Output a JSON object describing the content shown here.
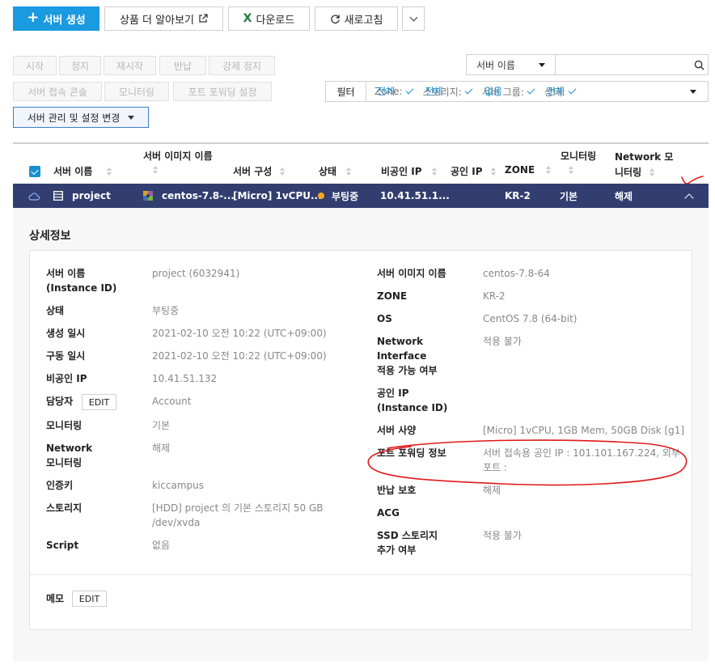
{
  "toolbar": {
    "create": "서버 생성",
    "learn_more": "상품 더 알아보기",
    "download": "다운로드",
    "refresh": "새로고침"
  },
  "actions": {
    "start": "시작",
    "stop": "정지",
    "restart": "재시작",
    "return": "반납",
    "force_stop": "강제 정지",
    "console": "서버 접속 콘솔",
    "monitoring": "모니터링",
    "port_forward": "포트 포워딩 설정",
    "manage": "서버 관리 및 설정 변경"
  },
  "search": {
    "field": "서버 이름",
    "placeholder": ""
  },
  "filter": {
    "label": "필터",
    "zone_label": "Zone:",
    "zone_val": "전체",
    "storage_label": "스토리지:",
    "storage_val": "전체",
    "group_label": "서버 그룹:",
    "group_val": "없음",
    "status_label": "상태:",
    "status_val": "전체"
  },
  "table": {
    "headers": {
      "name": "서버 이름",
      "image_l1": "서버 이미지 이름",
      "spec": "서버 구성",
      "status": "상태",
      "private_ip": "비공인 IP",
      "public_ip": "공인 IP",
      "zone": "ZONE",
      "monitoring": "모니터링",
      "net_mon_l1": "Network 모",
      "net_mon_l2": "니터링"
    },
    "row": {
      "name": "project",
      "image": "centos-7.8-...",
      "spec": "[Micro] 1vCPU...",
      "status": "부팅중",
      "private_ip": "10.41.51.1...",
      "public_ip": "",
      "zone": "KR-2",
      "monitoring": "기본",
      "net_mon": "해제"
    }
  },
  "detail": {
    "title": "상세정보",
    "left": {
      "name_label_1": "서버 이름",
      "name_label_2": "(Instance ID)",
      "name_val": "project (6032941)",
      "status_label": "상태",
      "status_val": "부팅중",
      "created_label": "생성 일시",
      "created_val": "2021-02-10 오전 10:22 (UTC+09:00)",
      "run_label": "구동 일시",
      "run_val": "2021-02-10 오전 10:22 (UTC+09:00)",
      "pip_label": "비공인 IP",
      "pip_val": "10.41.51.132",
      "owner_label": "담당자",
      "owner_edit": "EDIT",
      "owner_val": "Account",
      "mon_label": "모니터링",
      "mon_val": "기본",
      "netmon_label_1": "Network",
      "netmon_label_2": "모니터링",
      "netmon_val": "해제",
      "key_label": "인증키",
      "key_val": "kiccampus",
      "storage_label": "스토리지",
      "storage_val_1": "[HDD] project 의 기본 스토리지  50 GB",
      "storage_val_2": "/dev/xvda",
      "script_label": "Script",
      "script_val": "없음"
    },
    "right": {
      "image_label": "서버 이미지 이름",
      "image_val": "centos-7.8-64",
      "zone_label": "ZONE",
      "zone_val": "KR-2",
      "os_label": "OS",
      "os_val": "CentOS 7.8 (64-bit)",
      "ni_label_1": "Network",
      "ni_label_2": "Interface",
      "ni_label_3": "적용 가능 여부",
      "ni_val": "적용 불가",
      "pubip_label_1": "공인 IP",
      "pubip_label_2": "(Instance ID)",
      "spec_label": "서버 사양",
      "spec_val": "[Micro] 1vCPU, 1GB Mem, 50GB Disk [g1]",
      "pf_label": "포트 포워딩 정보",
      "pf_val_1": "서버 접속용 공인 IP : 101.101.167.224, 외부",
      "pf_val_2": "포트 :",
      "return_label": "반납 보호",
      "return_val": "해제",
      "acg_label": "ACG",
      "ssd_label_1": "SSD 스토리지",
      "ssd_label_2": "추가 여부",
      "ssd_val": "적용 불가"
    },
    "memo_label": "메모",
    "memo_edit": "EDIT"
  },
  "colors": {
    "primary": "#1a9ae0",
    "row_selected": "#323e70",
    "annotation": "#e01818",
    "status_dot": "#f5a623"
  }
}
